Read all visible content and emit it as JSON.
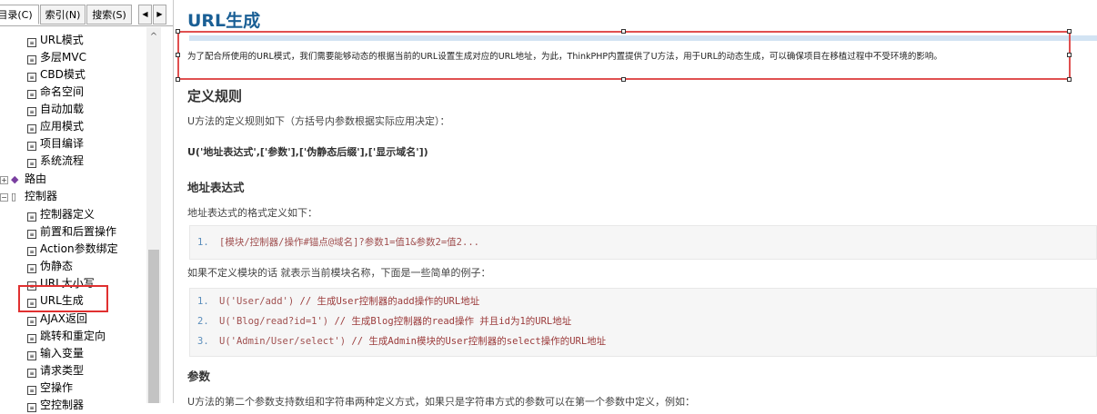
{
  "tabs": {
    "contents": "目录(C)",
    "index": "索引(N)",
    "search": "搜索(S)"
  },
  "tree": {
    "items": [
      {
        "label": "URL模式"
      },
      {
        "label": "多层MVC"
      },
      {
        "label": "CBD模式"
      },
      {
        "label": "命名空间"
      },
      {
        "label": "自动加载"
      },
      {
        "label": "应用模式"
      },
      {
        "label": "项目编译"
      },
      {
        "label": "系统流程"
      },
      {
        "label": "路由"
      },
      {
        "label": "控制器"
      },
      {
        "label": "控制器定义"
      },
      {
        "label": "前置和后置操作"
      },
      {
        "label": "Action参数绑定"
      },
      {
        "label": "伪静态"
      },
      {
        "label": "URL大小写"
      },
      {
        "label": "URL生成"
      },
      {
        "label": "AJAX返回"
      },
      {
        "label": "跳转和重定向"
      },
      {
        "label": "输入变量"
      },
      {
        "label": "请求类型"
      },
      {
        "label": "空操作"
      },
      {
        "label": "空控制器"
      }
    ],
    "selected": "URL生成"
  },
  "doc": {
    "title": "URL生成",
    "intro": "为了配合所使用的URL模式，我们需要能够动态的根据当前的URL设置生成对应的URL地址，为此，ThinkPHP内置提供了U方法，用于URL的动态生成，可以确保项目在移植过程中不受环境的影响。",
    "section_rules": "定义规则",
    "rules_desc": "U方法的定义规则如下（方括号内参数根据实际应用决定）：",
    "signature": "U('地址表达式',['参数'],['伪静态后缀'],['显示域名'])",
    "section_address": "地址表达式",
    "address_desc": "地址表达式的格式定义如下：",
    "code1": [
      {
        "n": "1.",
        "code": "[模块/控制器/操作#锚点@域名]?参数1=值1&参数2=值2..."
      }
    ],
    "example_desc": "如果不定义模块的话 就表示当前模块名称，下面是一些简单的例子：",
    "code2": [
      {
        "n": "1.",
        "call": "U('User/add')",
        "comment": "// 生成User控制器的add操作的URL地址"
      },
      {
        "n": "2.",
        "call": "U('Blog/read?id=1')",
        "comment": "// 生成Blog控制器的read操作 并且id为1的URL地址"
      },
      {
        "n": "3.",
        "call": "U('Admin/User/select')",
        "comment": "// 生成Admin模块的User控制器的select操作的URL地址"
      }
    ],
    "section_params": "参数",
    "params_desc": "U方法的第二个参数支持数组和字符串两种定义方式，如果只是字符串方式的参数可以在第一个参数中定义，例如："
  }
}
